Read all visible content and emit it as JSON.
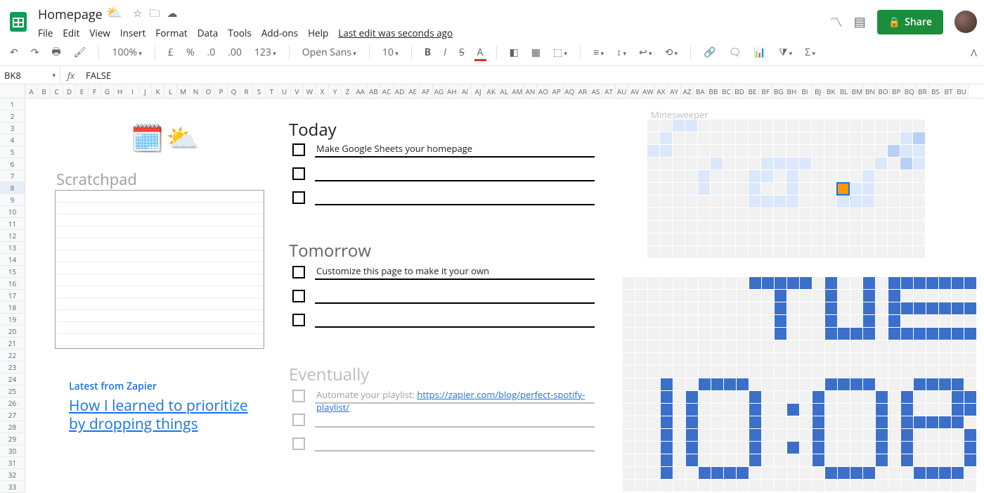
{
  "doc": {
    "title": "Homepage",
    "title_emoji": "⛅",
    "last_edit": "Last edit was seconds ago"
  },
  "menus": [
    "File",
    "Edit",
    "View",
    "Insert",
    "Format",
    "Data",
    "Tools",
    "Add-ons",
    "Help"
  ],
  "toolbar": {
    "zoom": "100%",
    "currency": "£",
    "number_fmt": "123",
    "font_name": "Open Sans",
    "font_size": "10"
  },
  "namebox": "BK8",
  "formula_value": "FALSE",
  "share_label": "Share",
  "row_count": 33,
  "columns_single": [
    "A",
    "B",
    "C",
    "D",
    "E",
    "F",
    "G",
    "H",
    "I",
    "J",
    "K",
    "L",
    "M",
    "N",
    "O",
    "P",
    "Q",
    "R",
    "S",
    "T",
    "U",
    "V",
    "W",
    "X",
    "Y",
    "Z"
  ],
  "columns_double": [
    "AA",
    "AB",
    "AC",
    "AD",
    "AE",
    "AF",
    "AG",
    "AH",
    "AI",
    "AJ",
    "AK",
    "AL",
    "AM",
    "AN",
    "AO",
    "AP",
    "AQ",
    "AR",
    "AS",
    "AT",
    "AU",
    "AV",
    "AW",
    "AX",
    "AY",
    "AZ",
    "BA",
    "BB",
    "BC",
    "BD",
    "BE",
    "BF",
    "BG",
    "BH",
    "BI",
    "BJ",
    "BK",
    "BL",
    "BM",
    "BN",
    "BO",
    "BP",
    "BQ",
    "BR",
    "BS",
    "BT",
    "BU"
  ],
  "scratchpad": {
    "title": "Scratchpad"
  },
  "sections": {
    "today": {
      "title": "Today",
      "items": [
        "Make Google Sheets your homepage",
        "",
        ""
      ]
    },
    "tomorrow": {
      "title": "Tomorrow",
      "items": [
        "Customize this page to make it your own",
        "",
        ""
      ]
    },
    "eventually": {
      "title": "Eventually",
      "item_prefix": "Automate your playlist: ",
      "item_link": "https://zapier.com/blog/perfect-spotify-playlist/",
      "items_rest": [
        "",
        ""
      ]
    }
  },
  "zapier": {
    "header": "Latest from Zapier",
    "headline": "How I learned to prioritize by dropping things"
  },
  "minesweeper": {
    "title": "Minesweeper",
    "cols": 22,
    "rows": 11,
    "cells_b1": [
      [
        0,
        2
      ],
      [
        0,
        3
      ],
      [
        1,
        1
      ],
      [
        2,
        0
      ],
      [
        2,
        1
      ],
      [
        3,
        5
      ],
      [
        4,
        4
      ],
      [
        5,
        4
      ],
      [
        4,
        8
      ],
      [
        4,
        9
      ],
      [
        3,
        9
      ],
      [
        3,
        10
      ],
      [
        3,
        11
      ],
      [
        3,
        12
      ],
      [
        4,
        11
      ],
      [
        5,
        11
      ],
      [
        6,
        11
      ],
      [
        6,
        10
      ],
      [
        6,
        9
      ],
      [
        6,
        8
      ],
      [
        5,
        8
      ],
      [
        1,
        20
      ],
      [
        2,
        20
      ],
      [
        2,
        21
      ],
      [
        3,
        21
      ],
      [
        3,
        18
      ],
      [
        4,
        17
      ],
      [
        5,
        16
      ],
      [
        6,
        15
      ],
      [
        6,
        16
      ],
      [
        6,
        17
      ],
      [
        5,
        17
      ]
    ],
    "cells_b2": [
      [
        2,
        19
      ],
      [
        3,
        20
      ],
      [
        1,
        21
      ]
    ],
    "selected": [
      5,
      15
    ]
  },
  "clock": {
    "cols": 28,
    "rows": 17,
    "tue_on": [
      [
        0,
        10
      ],
      [
        0,
        11
      ],
      [
        0,
        12
      ],
      [
        0,
        13
      ],
      [
        0,
        14
      ],
      [
        1,
        12
      ],
      [
        2,
        12
      ],
      [
        3,
        12
      ],
      [
        4,
        12
      ],
      [
        0,
        16
      ],
      [
        1,
        16
      ],
      [
        2,
        16
      ],
      [
        3,
        16
      ],
      [
        4,
        16
      ],
      [
        4,
        17
      ],
      [
        4,
        18
      ],
      [
        4,
        19
      ],
      [
        3,
        19
      ],
      [
        2,
        19
      ],
      [
        1,
        19
      ],
      [
        0,
        19
      ],
      [
        0,
        21
      ],
      [
        0,
        22
      ],
      [
        0,
        23
      ],
      [
        0,
        24
      ],
      [
        0,
        25
      ],
      [
        0,
        26
      ],
      [
        0,
        27
      ],
      [
        1,
        21
      ],
      [
        2,
        21
      ],
      [
        2,
        22
      ],
      [
        2,
        23
      ],
      [
        2,
        24
      ],
      [
        2,
        25
      ],
      [
        2,
        26
      ],
      [
        2,
        27
      ],
      [
        3,
        21
      ],
      [
        4,
        21
      ],
      [
        4,
        22
      ],
      [
        4,
        23
      ],
      [
        4,
        24
      ],
      [
        4,
        25
      ],
      [
        4,
        26
      ],
      [
        4,
        27
      ]
    ],
    "time_on": [
      [
        8,
        3
      ],
      [
        9,
        3
      ],
      [
        10,
        3
      ],
      [
        11,
        3
      ],
      [
        12,
        3
      ],
      [
        13,
        3
      ],
      [
        14,
        3
      ],
      [
        15,
        3
      ],
      [
        8,
        6
      ],
      [
        8,
        7
      ],
      [
        8,
        8
      ],
      [
        8,
        9
      ],
      [
        9,
        5
      ],
      [
        10,
        5
      ],
      [
        11,
        5
      ],
      [
        12,
        5
      ],
      [
        13,
        5
      ],
      [
        14,
        5
      ],
      [
        9,
        10
      ],
      [
        10,
        10
      ],
      [
        11,
        10
      ],
      [
        12,
        10
      ],
      [
        13,
        10
      ],
      [
        14,
        10
      ],
      [
        15,
        6
      ],
      [
        15,
        7
      ],
      [
        15,
        8
      ],
      [
        15,
        9
      ],
      [
        10,
        13
      ],
      [
        13,
        13
      ],
      [
        8,
        16
      ],
      [
        8,
        17
      ],
      [
        8,
        18
      ],
      [
        8,
        19
      ],
      [
        9,
        15
      ],
      [
        10,
        15
      ],
      [
        11,
        15
      ],
      [
        12,
        15
      ],
      [
        13,
        15
      ],
      [
        14,
        15
      ],
      [
        9,
        20
      ],
      [
        10,
        20
      ],
      [
        11,
        20
      ],
      [
        12,
        20
      ],
      [
        13,
        20
      ],
      [
        14,
        20
      ],
      [
        15,
        16
      ],
      [
        15,
        17
      ],
      [
        15,
        18
      ],
      [
        15,
        19
      ],
      [
        8,
        23
      ],
      [
        8,
        24
      ],
      [
        8,
        25
      ],
      [
        8,
        26
      ],
      [
        9,
        22
      ],
      [
        10,
        22
      ],
      [
        11,
        22
      ],
      [
        11,
        23
      ],
      [
        11,
        24
      ],
      [
        11,
        25
      ],
      [
        11,
        26
      ],
      [
        9,
        26
      ],
      [
        10,
        26
      ],
      [
        9,
        27
      ],
      [
        10,
        27
      ],
      [
        12,
        27
      ],
      [
        13,
        27
      ],
      [
        14,
        27
      ],
      [
        12,
        22
      ],
      [
        13,
        22
      ],
      [
        14,
        22
      ],
      [
        15,
        23
      ],
      [
        15,
        24
      ],
      [
        15,
        25
      ],
      [
        15,
        26
      ]
    ]
  }
}
